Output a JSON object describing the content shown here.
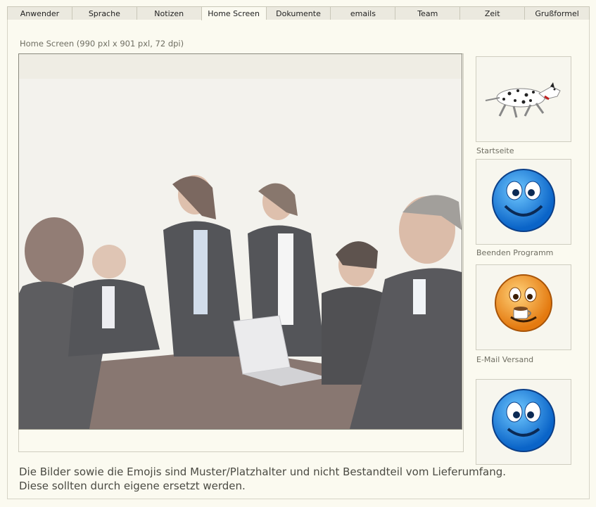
{
  "tabs": [
    {
      "label": "Anwender"
    },
    {
      "label": "Sprache"
    },
    {
      "label": "Notizen"
    },
    {
      "label": "Home Screen",
      "active": true
    },
    {
      "label": "Dokumente"
    },
    {
      "label": "emails"
    },
    {
      "label": "Team"
    },
    {
      "label": "Zeit"
    },
    {
      "label": "Grußformel"
    }
  ],
  "main": {
    "image_caption": "Home Screen (990 pxl x 901 pxl, 72 dpi)"
  },
  "side_tiles": [
    {
      "label": "Startseite",
      "icon": "dalmatian-dog-icon"
    },
    {
      "label": "Beenden Programm",
      "icon": "smiley-blue-icon"
    },
    {
      "label": "E-Mail Versand",
      "icon": "smiley-coffee-icon"
    },
    {
      "label": "",
      "icon": "smiley-blue-wide-eyes-icon"
    }
  ],
  "note": {
    "line1": "Die Bilder sowie die Emojis sind Muster/Platzhalter und nicht Bestandteil vom Lieferumfang.",
    "line2": "Diese sollten durch eigene ersetzt werden."
  }
}
